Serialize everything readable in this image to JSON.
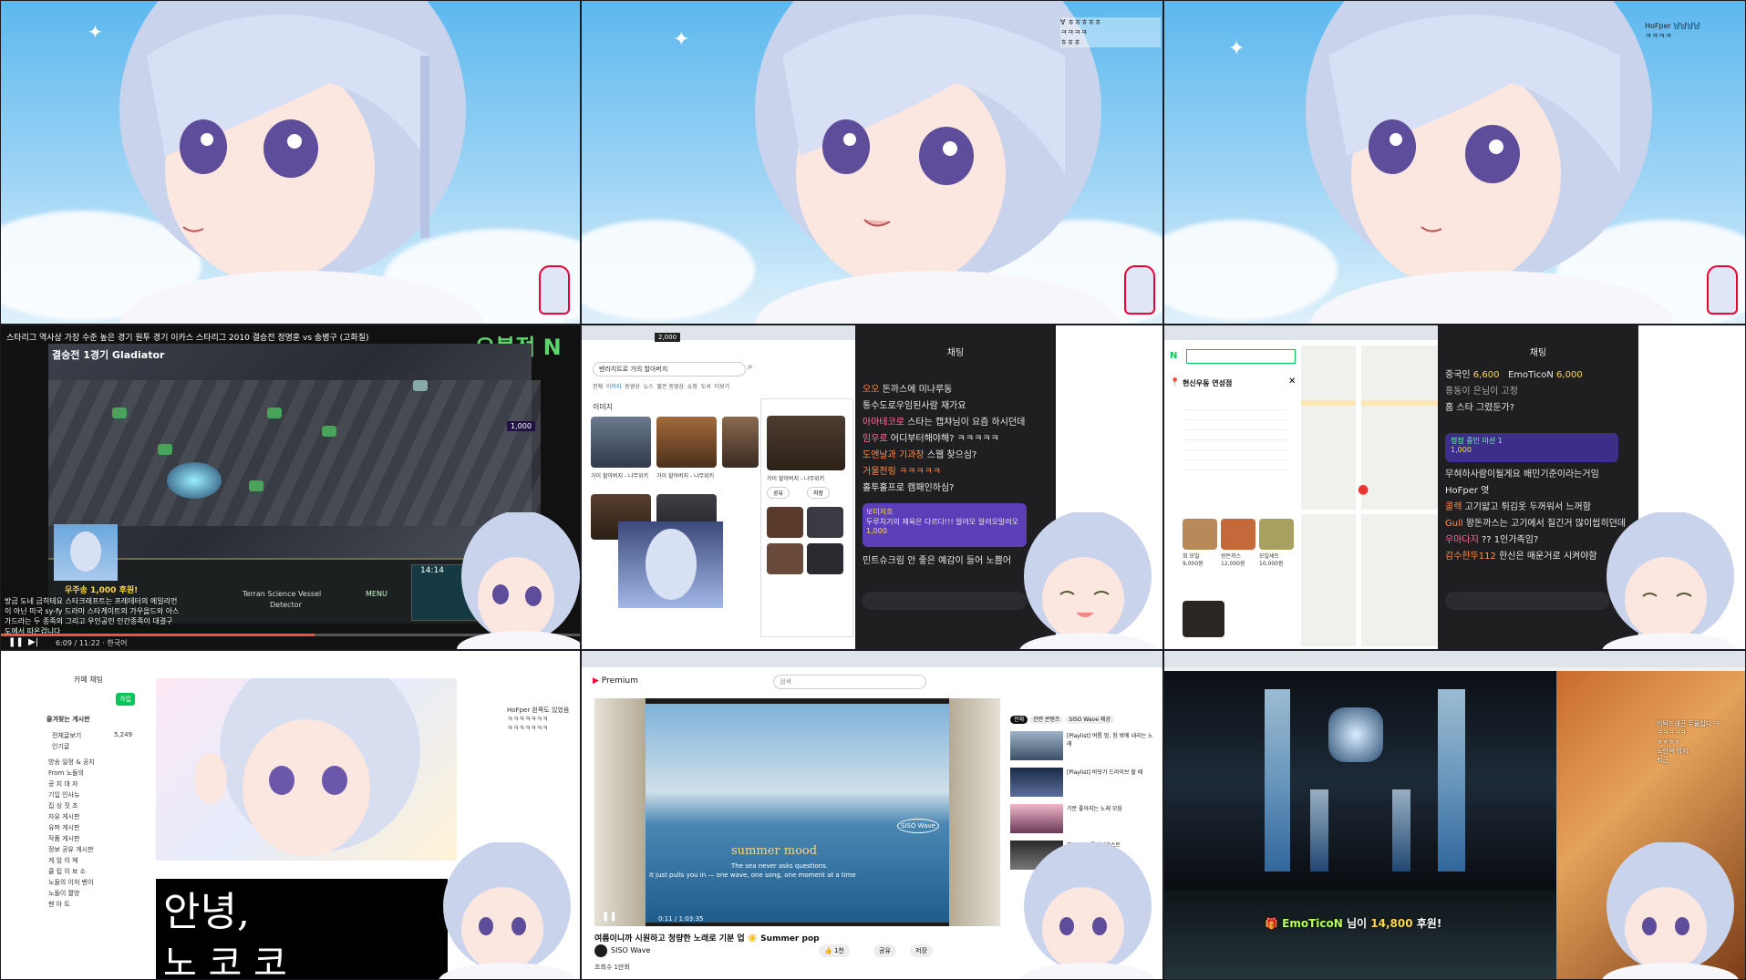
{
  "cells": {
    "top": [
      {
        "id": "cam-1"
      },
      {
        "id": "cam-2",
        "chat": [
          "Ɐ ㅎㅎㅎㅎㅎ",
          "ㅋㅋㅋㅋ",
          "ㅎㅎㅎ"
        ]
      },
      {
        "id": "cam-3",
        "chat": [
          "HoFper 냠냠냠냠",
          "ㅋㅋㅋㅋ"
        ]
      }
    ],
    "starcraft": {
      "video_title": "스타리그 역사상 가장 수준 높은 경기 원투 경기  이카스 스타리그 2010 결승전 정명훈 vs 송병구 (고화질)",
      "logo_text": "오블점 N",
      "match_label": "결승전 1경기 Gladiator",
      "player_names": [
        "Terran Science Vessel",
        "Detector"
      ],
      "menu_label": "MENU",
      "game_time": "14:14",
      "donation": "우주송 1,000 후원!",
      "side_badge": "1,000",
      "subtitle_lines": [
        "방금 도네 금히테요 스타크래프트는 프레데터의 에일리언",
        "이 아닌 미국 sy-fy 드라마 스타게이트의 가우을드와 아스",
        "가드라는 두 종족의 그리고 우인공인 인간종족이 대결구",
        "도에서 따온겁니다"
      ],
      "player_time": "6:09 / 11:22 · 한국어"
    },
    "search": {
      "query": "벤라치트로 가의 할아버지",
      "tabs": [
        "전체",
        "이미지",
        "동영상",
        "뉴스",
        "짧은 동영상",
        "쇼핑",
        "도서",
        "더보기"
      ],
      "section_label": "이미지",
      "result_captions": [
        "가이 할아버지 - 나무위키",
        "가이 할아버지 - 나무위키",
        "가이 할아버지 - 나무위키"
      ],
      "share_label": "공유",
      "save_label": "저장",
      "stream_badge": "2,000",
      "chat_header": "채팅",
      "chat_lines": [
        {
          "user": "오오",
          "text": "돈까스에 미나루동"
        },
        {
          "user": "",
          "text": "통수도로우임된사람 재가요"
        },
        {
          "user": "아마테코로",
          "text": "스타는 캡챠님이 요즘 하시던데"
        },
        {
          "user": "임우로",
          "text": "어디부터해야해? ㅋㅋㅋㅋㅋ"
        },
        {
          "user": "도엔날과 기과장",
          "text": "스웹 찾으심?"
        },
        {
          "user": "",
          "text": "거울전링 ㅋㅋㅋㅋㅋ"
        },
        {
          "user": "",
          "text": "홀투홀프로 캠패인하심?"
        }
      ],
      "highlight_user": "보미저흐",
      "highlight_text": "두루치기의 제육은 다르다!!! 알려오 알려오알려오",
      "highlight_amount": "1,000",
      "last_line": "민트슈크림  안 좋은 예감이 들어 노쁨어"
    },
    "map": {
      "place": "현신우동 연성점",
      "chat_header": "채팅",
      "ranks": [
        {
          "name": "중국인",
          "amount": "6,600"
        },
        {
          "name": "EmoTicoN",
          "amount": "6,000"
        }
      ],
      "pinned": "홍동이 은님이 고정",
      "pinned_text": "홈 스타 그렸둔가?",
      "donation_title": "정정 중인 미션 1",
      "donation_amount": "1,000",
      "chat_lines": [
        {
          "user": "",
          "text": "무혀하사람이될게요 배민기준이라는거임"
        },
        {
          "user": "",
          "text": "HoFper 엿"
        },
        {
          "user": "콜렉",
          "text": "고기얇고 튀김옷 두꺼워서 느꺼함"
        },
        {
          "user": "Gull",
          "text": "왕돈까스는 고기에서 질긴거 많이씹히던데"
        },
        {
          "user": "우마다지",
          "text": "?? 1인가족임?"
        },
        {
          "user": "감수한뚜112",
          "text": "한신은 매운거로 시켜야함"
        }
      ],
      "food_labels": [
        "회 모밀",
        "왕돈까스",
        "모밀세트"
      ],
      "prices": [
        "9,000원",
        "12,000원",
        "10,000원"
      ]
    },
    "cafe": {
      "sidebar_title": "카페 채팅",
      "join_label": "가입",
      "favorites": "즐겨찾는 게시판",
      "all_posts": "전체글보기",
      "count": "5,249",
      "popular": "인기글",
      "board_items": [
        "방송 일정 & 공지",
        "From 노돌의",
        "공 지 대 자",
        "기입 인사뉴",
        "집 싱 짓 조",
        "자유 게시판",
        "유머 게시판",
        "작품 게시판",
        "정보 공유 게시판",
        "게 임 이 쳬",
        "클 립 이 보 소",
        "노돌의 이처 벤이",
        "노돌이 짤방",
        "팬 아 트"
      ],
      "big_text": "안녕,",
      "big_text_2": "노 코 코",
      "chat_lines": [
        "HoFper 왼쪽도 있었음",
        "ㅋㅋㅋㅋㅋㅋㅋ",
        "ㅋㅋㅋㅋㅋㅋㅋ"
      ]
    },
    "youtube": {
      "brand": "Premium",
      "search_placeholder": "검색",
      "title_overlay": "summer mood",
      "subtitle_overlay": "The sea never asks questions.",
      "subtitle_overlay_2": "It just pulls you in — one wave, one song, one moment at a time",
      "time": "0:11 / 1:03:35",
      "video_title": "여름이니까 시원하고 청량한 노래로 기분 업 ☀️ Summer pop",
      "channel": "SISO Wave",
      "chips": [
        "전체",
        "관련 콘텐츠",
        "SISO Wave 제공"
      ],
      "like_count": "1천",
      "share": "공유",
      "save": "저장",
      "views": "조회수 1만회",
      "side_titles": [
        "[Playlist] 여름 밤, 창 밖에 내리는 노래",
        "[Playlist] 바닷가 드라이브 할 때",
        "기분 좋아지는 노래 모음",
        "하루의 끝 플레이리스트"
      ],
      "window_label": "SISO Wave"
    },
    "final": {
      "donation_user": "EmoTicoN",
      "donation_mid": "님이",
      "donation_amount": "14,800",
      "donation_suffix": "후원!",
      "chat_lines": [
        "비틱드래곤 두물입디 ㅋ",
        "ㅋㅋㅋㅋㅋ",
        "ㅎㅎㅎㅎ",
        "노란색 뭐지",
        "퇴근"
      ]
    }
  },
  "colors": {
    "sky": "#5cb8ee",
    "chat_bg": "#1f1f22",
    "chzzk_green": "#00ffa3",
    "youtube_red": "#ff0033",
    "purple": "#5a3fb8"
  },
  "icons": [
    "sparkle-icon",
    "search-icon",
    "play-icon",
    "pause-icon",
    "map-pin-icon",
    "close-icon",
    "heart-icon",
    "settings-icon"
  ]
}
